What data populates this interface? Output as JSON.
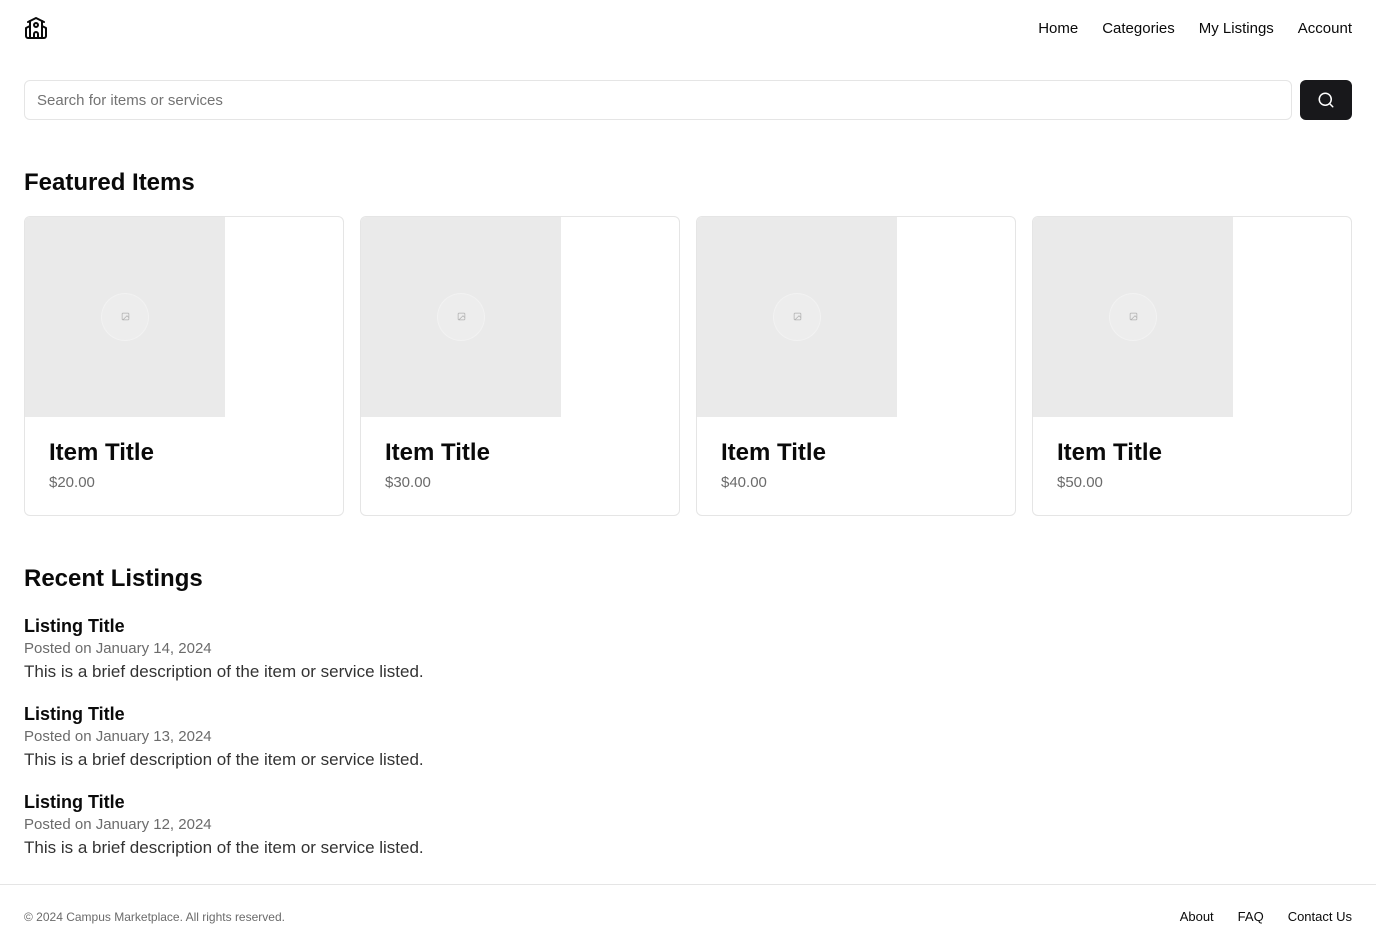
{
  "header": {
    "logo_icon": "school-building-icon",
    "nav": [
      "Home",
      "Categories",
      "My Listings",
      "Account"
    ]
  },
  "search": {
    "placeholder": "Search for items or services",
    "value": "",
    "button_icon": "search-icon"
  },
  "featured": {
    "title": "Featured Items",
    "items": [
      {
        "title": "Item Title",
        "price": "$20.00"
      },
      {
        "title": "Item Title",
        "price": "$30.00"
      },
      {
        "title": "Item Title",
        "price": "$40.00"
      },
      {
        "title": "Item Title",
        "price": "$50.00"
      }
    ]
  },
  "recent": {
    "title": "Recent Listings",
    "listings": [
      {
        "title": "Listing Title",
        "date": "Posted on January 14, 2024",
        "description": "This is a brief description of the item or service listed."
      },
      {
        "title": "Listing Title",
        "date": "Posted on January 13, 2024",
        "description": "This is a brief description of the item or service listed."
      },
      {
        "title": "Listing Title",
        "date": "Posted on January 12, 2024",
        "description": "This is a brief description of the item or service listed."
      }
    ]
  },
  "footer": {
    "copyright": "© 2024 Campus Marketplace. All rights reserved.",
    "links": [
      "About",
      "FAQ",
      "Contact Us"
    ]
  },
  "colors": {
    "primary_button": "#18181b",
    "border": "#e5e5e5",
    "muted_text": "#6b6b6b",
    "image_placeholder": "#eaeaea"
  }
}
